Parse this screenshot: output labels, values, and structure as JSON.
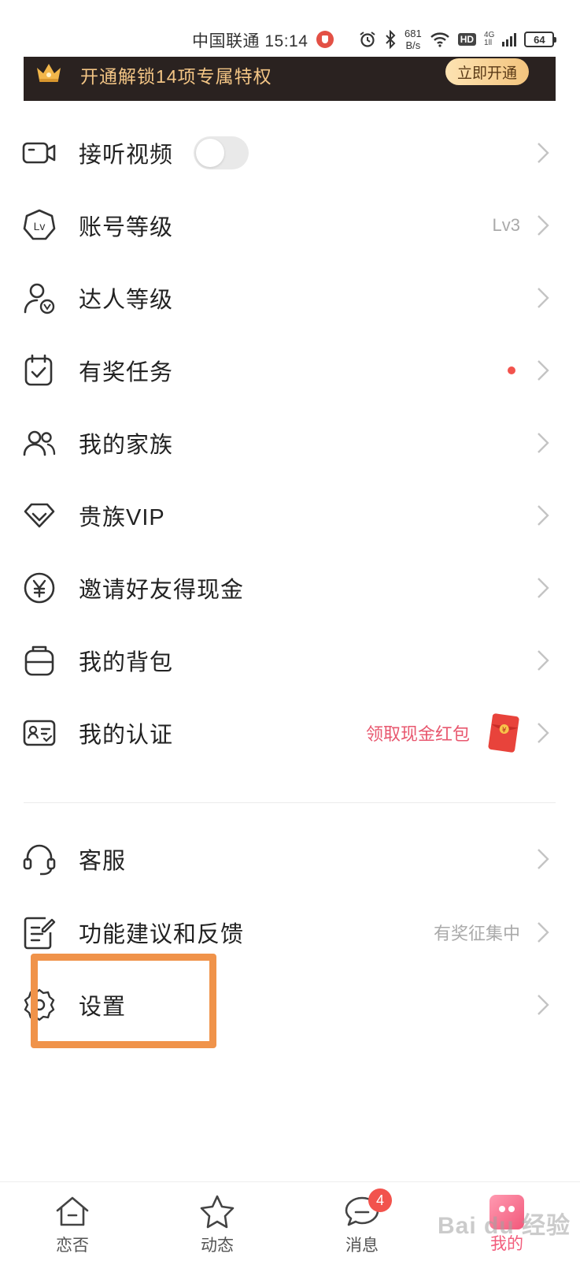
{
  "status_bar": {
    "carrier_time": "中国联通 15:14",
    "speed_value": "681",
    "speed_unit": "B/s",
    "hd": "HD",
    "net": "4G",
    "net_sub": "1ll",
    "battery": "64"
  },
  "vip_banner": {
    "text": "开通解锁14项专属特权",
    "button": "立即开通",
    "colors": {
      "background": "#2a2220",
      "text": "#f3c585"
    }
  },
  "menu": {
    "items": [
      {
        "label": "接听视频",
        "icon": "video-camera-icon",
        "toggle_on": false
      },
      {
        "label": "账号等级",
        "icon": "lv-badge-icon",
        "value": "Lv3"
      },
      {
        "label": "达人等级",
        "icon": "verified-user-icon"
      },
      {
        "label": "有奖任务",
        "icon": "calendar-check-icon",
        "has_dot": true
      },
      {
        "label": "我的家族",
        "icon": "users-icon"
      },
      {
        "label": "贵族VIP",
        "icon": "diamond-icon"
      },
      {
        "label": "邀请好友得现金",
        "icon": "yen-coin-icon"
      },
      {
        "label": "我的背包",
        "icon": "backpack-icon"
      },
      {
        "label": "我的认证",
        "icon": "id-card-icon",
        "value": "领取现金红包",
        "value_icon": "red-packet-icon"
      }
    ],
    "items2": [
      {
        "label": "客服",
        "icon": "headset-icon"
      },
      {
        "label": "功能建议和反馈",
        "icon": "edit-note-icon",
        "value": "有奖征集中"
      },
      {
        "label": "设置",
        "icon": "gear-icon"
      }
    ]
  },
  "tabbar": {
    "tabs": [
      {
        "label": "恋否",
        "icon": "home-icon"
      },
      {
        "label": "动态",
        "icon": "star-icon"
      },
      {
        "label": "消息",
        "icon": "chat-bubble-icon",
        "badge": "4"
      },
      {
        "label": "我的",
        "icon": "me-icon",
        "active": true
      }
    ]
  },
  "watermark": "Bai du 经验",
  "colors": {
    "accent_pink": "#f25d7c",
    "highlight_orange": "#f0934a",
    "badge_red": "#f2534d"
  }
}
